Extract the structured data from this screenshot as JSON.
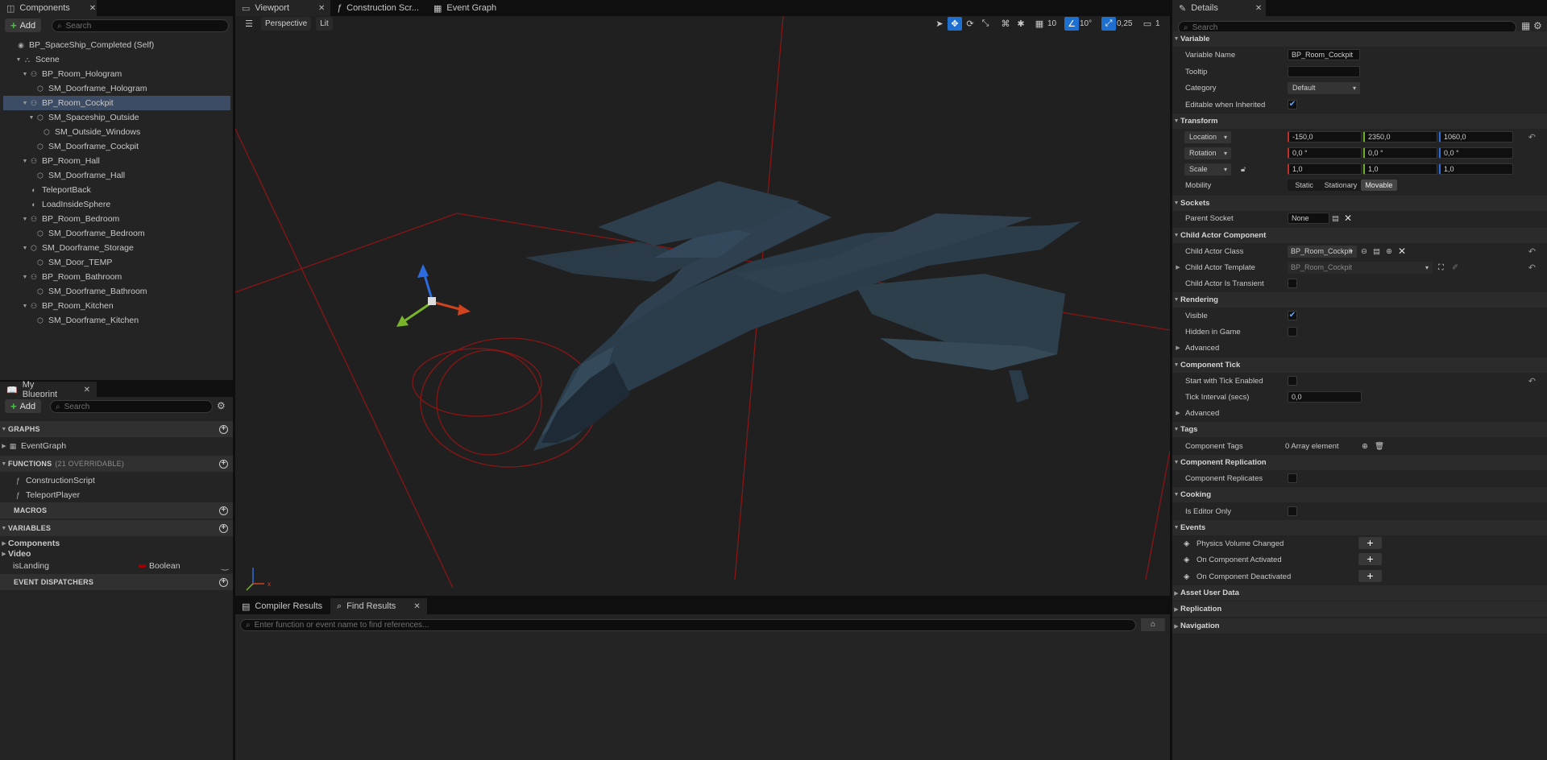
{
  "components_panel": {
    "tab_label": "Components",
    "add_label": "Add",
    "search_placeholder": "Search",
    "tree": [
      {
        "label": "BP_SpaceShip_Completed (Self)",
        "indent": 0,
        "icon": "self-icon",
        "tri": "",
        "selected": false
      },
      {
        "label": "Scene",
        "indent": 1,
        "icon": "scene-icon",
        "tri": "▼",
        "selected": false
      },
      {
        "label": "BP_Room_Hologram",
        "indent": 2,
        "icon": "child-actor-icon",
        "tri": "▼",
        "selected": false
      },
      {
        "label": "SM_Doorframe_Hologram",
        "indent": 3,
        "icon": "static-mesh-icon",
        "tri": "",
        "selected": false
      },
      {
        "label": "BP_Room_Cockpit",
        "indent": 2,
        "icon": "child-actor-icon",
        "tri": "▼",
        "selected": true
      },
      {
        "label": "SM_Spaceship_Outside",
        "indent": 3,
        "icon": "static-mesh-icon",
        "tri": "▼",
        "selected": false
      },
      {
        "label": "SM_Outside_Windows",
        "indent": 4,
        "icon": "static-mesh-icon",
        "tri": "",
        "selected": false
      },
      {
        "label": "SM_Doorframe_Cockpit",
        "indent": 3,
        "icon": "static-mesh-icon",
        "tri": "",
        "selected": false
      },
      {
        "label": "BP_Room_Hall",
        "indent": 2,
        "icon": "child-actor-icon",
        "tri": "▼",
        "selected": false
      },
      {
        "label": "SM_Doorframe_Hall",
        "indent": 3,
        "icon": "static-mesh-icon",
        "tri": "",
        "selected": false
      },
      {
        "label": "TeleportBack",
        "indent": 2,
        "icon": "sphere-icon",
        "tri": "",
        "selected": false
      },
      {
        "label": "LoadInsideSphere",
        "indent": 2,
        "icon": "sphere-icon",
        "tri": "",
        "selected": false
      },
      {
        "label": "BP_Room_Bedroom",
        "indent": 2,
        "icon": "child-actor-icon",
        "tri": "▼",
        "selected": false
      },
      {
        "label": "SM_Doorframe_Bedroom",
        "indent": 3,
        "icon": "static-mesh-icon",
        "tri": "",
        "selected": false
      },
      {
        "label": "SM_Doorframe_Storage",
        "indent": 2,
        "icon": "static-mesh-icon",
        "tri": "▼",
        "selected": false
      },
      {
        "label": "SM_Door_TEMP",
        "indent": 3,
        "icon": "static-mesh-icon",
        "tri": "",
        "selected": false
      },
      {
        "label": "BP_Room_Bathroom",
        "indent": 2,
        "icon": "child-actor-icon",
        "tri": "▼",
        "selected": false
      },
      {
        "label": "SM_Doorframe_Bathroom",
        "indent": 3,
        "icon": "static-mesh-icon",
        "tri": "",
        "selected": false
      },
      {
        "label": "BP_Room_Kitchen",
        "indent": 2,
        "icon": "child-actor-icon",
        "tri": "▼",
        "selected": false
      },
      {
        "label": "SM_Doorframe_Kitchen",
        "indent": 3,
        "icon": "static-mesh-icon",
        "tri": "",
        "selected": false
      }
    ]
  },
  "my_blueprint": {
    "tab_label": "My Blueprint",
    "add_label": "Add",
    "search_placeholder": "Search",
    "graphs_label": "GRAPHS",
    "event_graph": "EventGraph",
    "functions_label": "FUNCTIONS",
    "functions_count": "(21 OVERRIDABLE)",
    "construction_script": "ConstructionScript",
    "teleport_player": "TeleportPlayer",
    "macros_label": "MACROS",
    "variables_label": "VARIABLES",
    "var_group_components": "Components",
    "var_group_video": "Video",
    "var_name": "isLanding",
    "var_type": "Boolean",
    "event_dispatchers_label": "EVENT DISPATCHERS"
  },
  "editor_tabs": {
    "viewport": "Viewport",
    "construction": "Construction Scr...",
    "event_graph": "Event Graph"
  },
  "viewport": {
    "perspective": "Perspective",
    "lit": "Lit",
    "grid_snap": "10",
    "rot_snap": "10°",
    "scale_snap": "0,25",
    "cam_speed": "1"
  },
  "bottom": {
    "compiler_tab": "Compiler Results",
    "find_tab": "Find Results",
    "find_placeholder": "Enter function or event name to find references..."
  },
  "details": {
    "tab_label": "Details",
    "search_placeholder": "Search",
    "variable_cat": "Variable",
    "variable_name_label": "Variable Name",
    "variable_name_value": "BP_Room_Cockpit",
    "tooltip_label": "Tooltip",
    "category_label": "Category",
    "category_value": "Default",
    "editable_label": "Editable when Inherited",
    "transform_cat": "Transform",
    "location_label": "Location",
    "loc_x": "-150,0",
    "loc_y": "2350,0",
    "loc_z": "1060,0",
    "rotation_label": "Rotation",
    "rot_x": "0,0 °",
    "rot_y": "0,0 °",
    "rot_z": "0,0 °",
    "scale_label": "Scale",
    "scale_x": "1,0",
    "scale_y": "1,0",
    "scale_z": "1,0",
    "mobility_label": "Mobility",
    "mob_static": "Static",
    "mob_stationary": "Stationary",
    "mob_movable": "Movable",
    "sockets_cat": "Sockets",
    "parent_socket_label": "Parent Socket",
    "parent_socket_value": "None",
    "child_actor_cat": "Child Actor Component",
    "child_actor_class_label": "Child Actor Class",
    "child_actor_class_value": "BP_Room_Cockpit",
    "child_actor_template_label": "Child Actor Template",
    "child_actor_template_value": "BP_Room_Cockpit",
    "child_actor_transient_label": "Child Actor Is Transient",
    "rendering_cat": "Rendering",
    "visible_label": "Visible",
    "hidden_label": "Hidden in Game",
    "advanced_label": "Advanced",
    "component_tick_cat": "Component Tick",
    "start_tick_label": "Start with Tick Enabled",
    "tick_interval_label": "Tick Interval (secs)",
    "tick_interval_value": "0,0",
    "advanced2_label": "Advanced",
    "tags_cat": "Tags",
    "component_tags_label": "Component Tags",
    "component_tags_value": "0 Array element",
    "replication_cat": "Component Replication",
    "component_replicates_label": "Component Replicates",
    "cooking_cat": "Cooking",
    "editor_only_label": "Is Editor Only",
    "events_cat": "Events",
    "ev_physics": "Physics Volume Changed",
    "ev_activated": "On Component Activated",
    "ev_deactivated": "On Component Deactivated",
    "asset_user_data_cat": "Asset User Data",
    "replication2_cat": "Replication",
    "navigation_cat": "Navigation"
  },
  "colors": {
    "selection": "#3c4c64",
    "accent_blue": "#1d6fd0",
    "boolean_red": "#a00000"
  }
}
